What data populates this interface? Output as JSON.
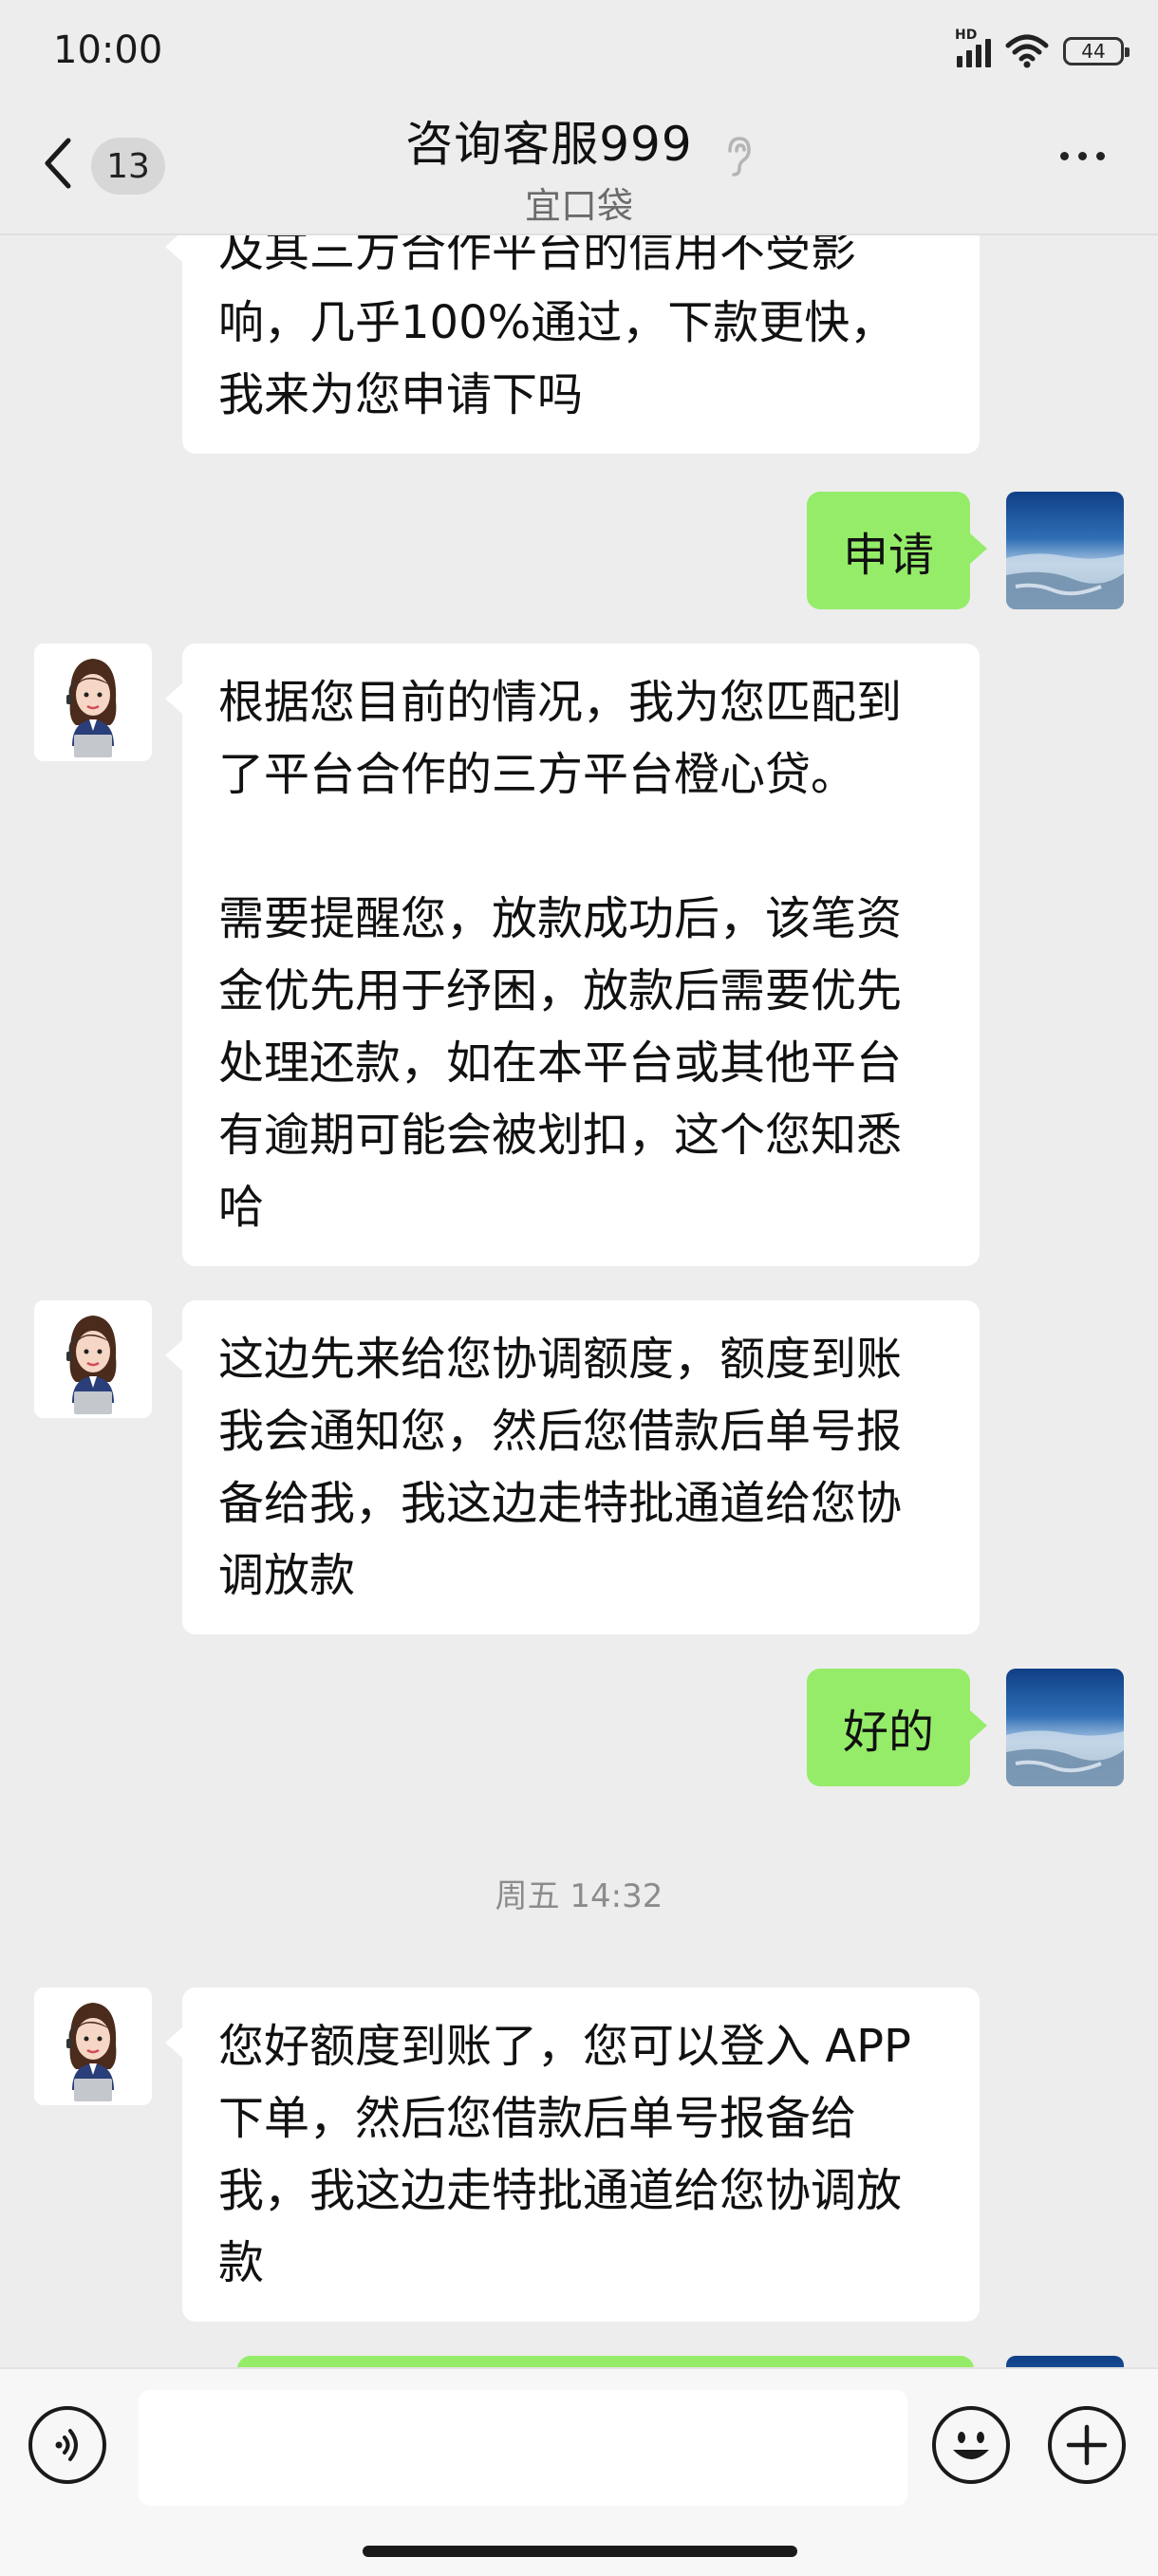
{
  "status_bar": {
    "time": "10:00",
    "network_label": "HD",
    "battery": "44"
  },
  "header": {
    "unread_count": "13",
    "title": "咨询客服999",
    "subtitle": "宜口袋"
  },
  "messages": [
    {
      "side": "left",
      "text": "及其三方合作平台的信用不受影\n响，几乎100%通过，下款更快，\n我来为您申请下吗"
    },
    {
      "side": "right",
      "text": "申请"
    },
    {
      "side": "left",
      "text": "根据您目前的情况，我为您匹配到\n了平台合作的三方平台橙心贷。\n\n需要提醒您，放款成功后，该笔资\n金优先用于纾困，放款后需要优先\n处理还款，如在本平台或其他平台\n有逾期可能会被划扣，这个您知悉\n哈"
    },
    {
      "side": "left",
      "text": "这边先来给您协调额度，额度到账\n我会通知您，然后您借款后单号报\n备给我，我这边走特批通道给您协\n调放款"
    },
    {
      "side": "right",
      "text": "好的"
    },
    {
      "timestamp": "周五 14:32"
    },
    {
      "side": "left",
      "text": "您好额度到账了，您可以登入 APP\n下单，然后您借款后单号报备给\n我，我这边走特批通道给您协调放\n款"
    }
  ],
  "colors": {
    "background": "#ededed",
    "sent_bubble": "#95ec69",
    "received_bubble": "#ffffff"
  }
}
